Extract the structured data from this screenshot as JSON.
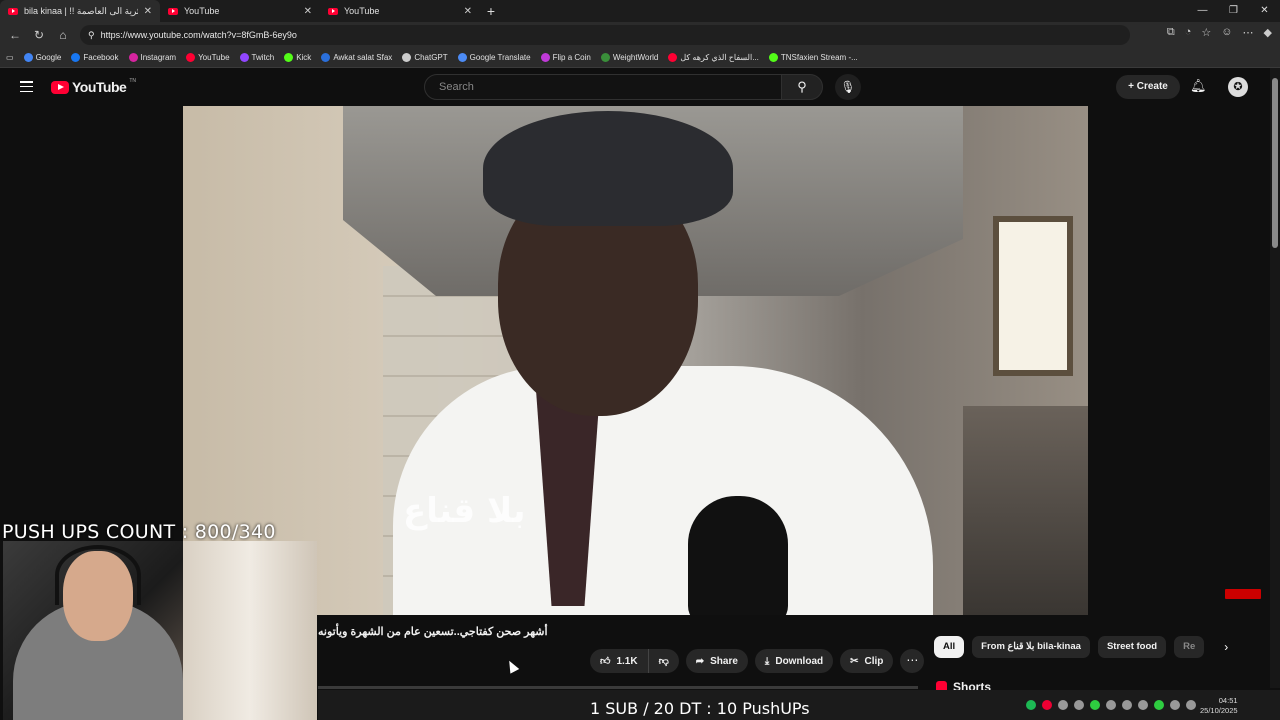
{
  "browser": {
    "tabs": [
      {
        "title": "bila kinaa | !! الجزائرية الى العاصمة"
      },
      {
        "title": "YouTube"
      },
      {
        "title": "YouTube"
      }
    ],
    "url": "https://www.youtube.com/watch?v=8fGmB-6ey9o",
    "bookmarks": [
      "Google",
      "Facebook",
      "Instagram",
      "YouTube",
      "Twitch",
      "Kick",
      "Awkat salat Sfax",
      "ChatGPT",
      "Google Translate",
      "Flip a Coin",
      "WeightWorld",
      "السفاح الذي كرهه كل...",
      "TNSfaxien Stream -..."
    ]
  },
  "youtube": {
    "logo_text": "YouTube",
    "logo_sup": "TN",
    "search_placeholder": "Search",
    "create_label": "Create"
  },
  "video": {
    "watermark": "بلا قناع",
    "title": "أشهر صحن كفتاجي..تسعين عام من الشهرة ويأتونه",
    "likes": "1.1K",
    "share_label": "Share",
    "download_label": "Download",
    "clip_label": "Clip"
  },
  "chips": [
    "All",
    "From بلا قناع bila-kinaa",
    "Street food",
    "Re"
  ],
  "shorts_label": "Shorts",
  "overlay": {
    "push_ups_count": "PUSH UPS COUNT : 800/340",
    "sub_line": "1 SUB / 20 DT : 10 PushUPs"
  },
  "clock": {
    "time": "04:51",
    "date": "25/10/2025"
  }
}
